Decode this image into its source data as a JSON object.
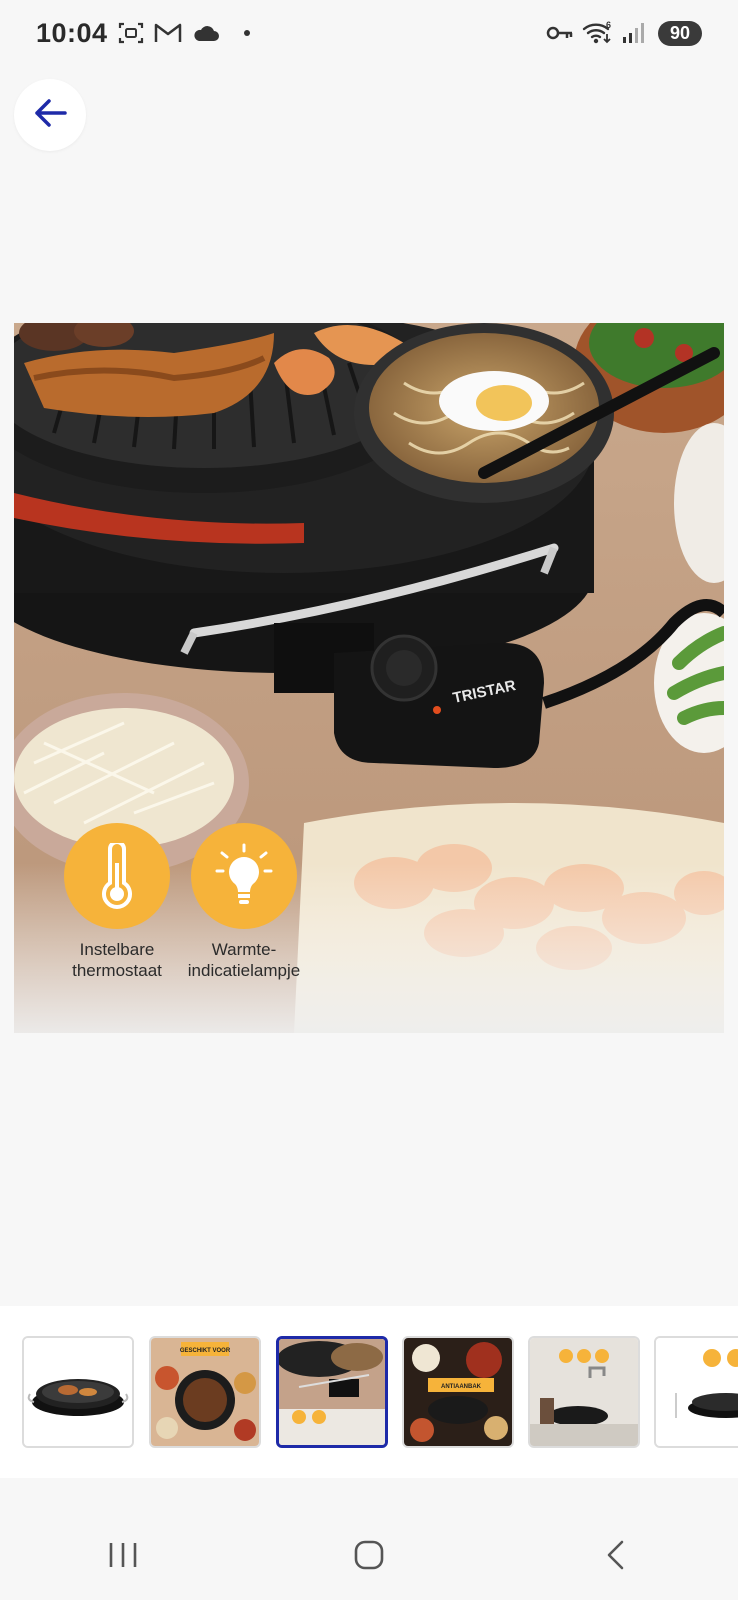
{
  "status_bar": {
    "time": "10:04",
    "battery": "90",
    "icons": [
      "screenshot-icon",
      "gmail-icon",
      "cloud-icon",
      "dot-icon",
      "key-icon",
      "wifi-icon",
      "signal-icon"
    ],
    "wifi_badge": "6"
  },
  "header": {
    "back_icon": "arrow-left-icon"
  },
  "product_image": {
    "brand": "TRISTAR",
    "features": [
      {
        "icon": "thermometer-icon",
        "label": "Instelbare\nthermostaat"
      },
      {
        "icon": "lightbulb-icon",
        "label": "Warmte-\nindicatielampje"
      }
    ],
    "accent_color": "#f6b33a"
  },
  "thumbnails": {
    "selected_index": 2,
    "items": [
      {
        "name": "thumb-grill-plain"
      },
      {
        "name": "thumb-geschikt-voor",
        "banner": "GESCHIKT VOOR"
      },
      {
        "name": "thumb-thermostat-closeup"
      },
      {
        "name": "thumb-antiaanbak",
        "banner": "ANTIAANBAK"
      },
      {
        "name": "thumb-dishwasher"
      },
      {
        "name": "thumb-dimensions"
      }
    ],
    "active_color": "#1e2aa8"
  },
  "nav_bar": {
    "recents_icon": "recents-icon",
    "home_icon": "home-icon",
    "back_icon": "back-chevron-icon"
  }
}
